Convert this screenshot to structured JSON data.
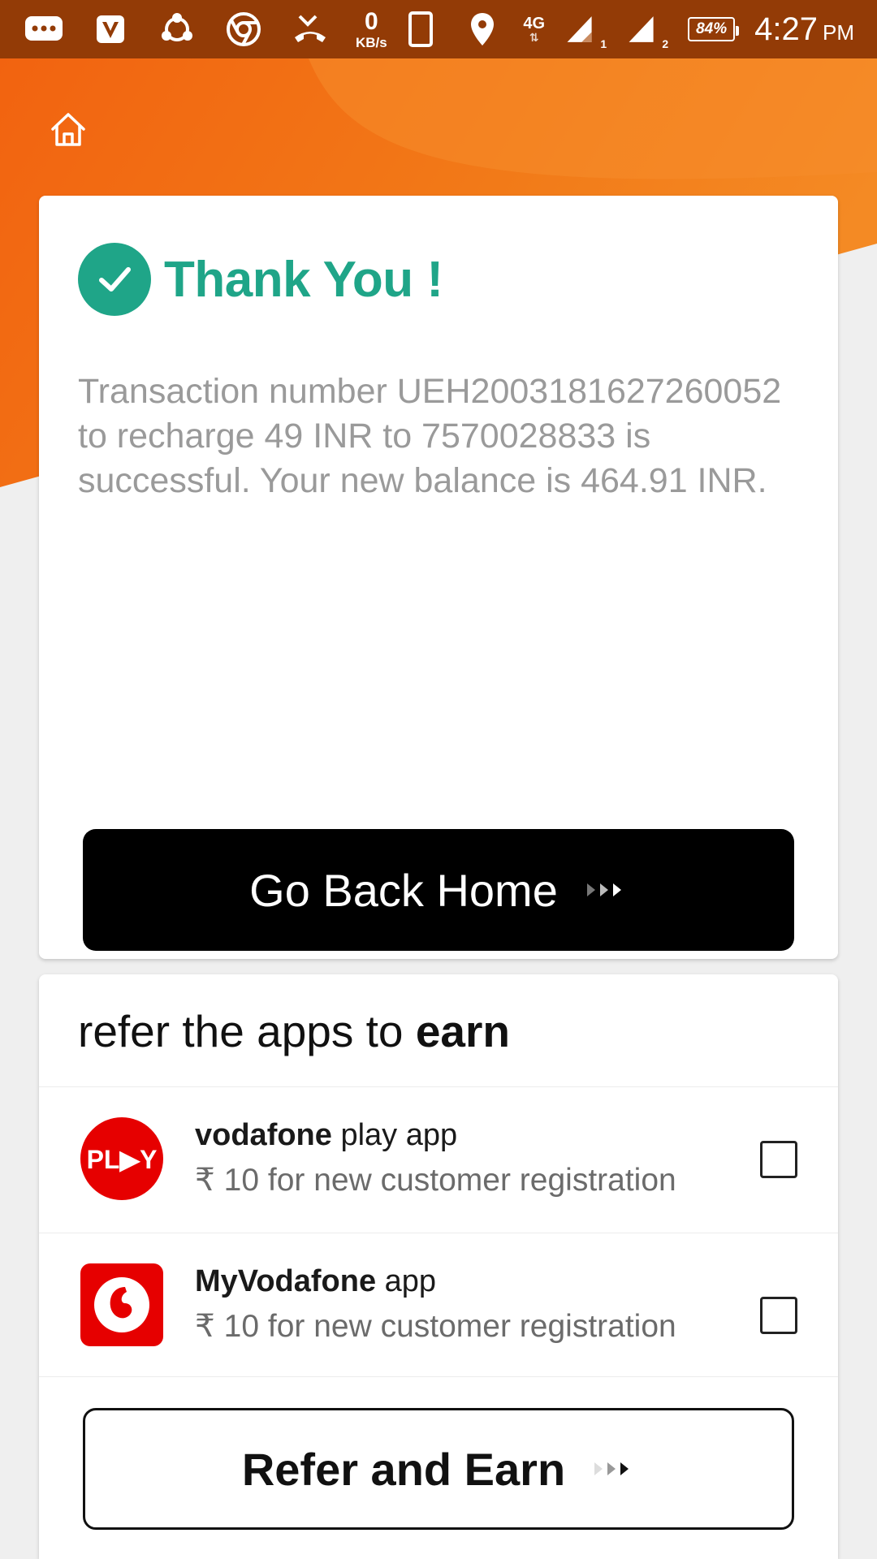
{
  "status_bar": {
    "speed_value": "0",
    "speed_unit": "KB/s",
    "network": "4G",
    "sim1": "1",
    "sim2": "2",
    "battery": "84%",
    "time": "4:27",
    "ampm": "PM",
    "icons": [
      "messages-icon",
      "vodafone-v-icon",
      "share-icon",
      "chrome-icon",
      "missed-call-icon",
      "phone-icon",
      "location-icon",
      "signal-icon",
      "signal-icon",
      "battery-icon"
    ]
  },
  "header": {
    "home_icon": "home-icon",
    "colors": {
      "orange": "#f26b10",
      "orange_light": "#f7962f",
      "status_bar": "#933b06"
    }
  },
  "confirmation": {
    "title": "Thank You !",
    "message": "Transaction number UEH2003181627260052 to recharge 49 INR to 7570028833 is successful. Your new balance is 464.91 INR.",
    "accent_color": "#1fa588",
    "go_home_label": "Go Back Home"
  },
  "refer": {
    "heading_prefix": "refer the apps to ",
    "heading_bold": "earn",
    "apps": [
      {
        "name_bold": "vodafone",
        "name_rest": " play app",
        "reward": "₹ 10 for new customer registration",
        "logo_text": "PL▶Y",
        "checked": false
      },
      {
        "name_bold": "MyVodafone",
        "name_rest": " app",
        "reward": "₹ 10 for new customer registration",
        "logo_text": "",
        "checked": false
      }
    ],
    "button_label": "Refer and Earn"
  }
}
